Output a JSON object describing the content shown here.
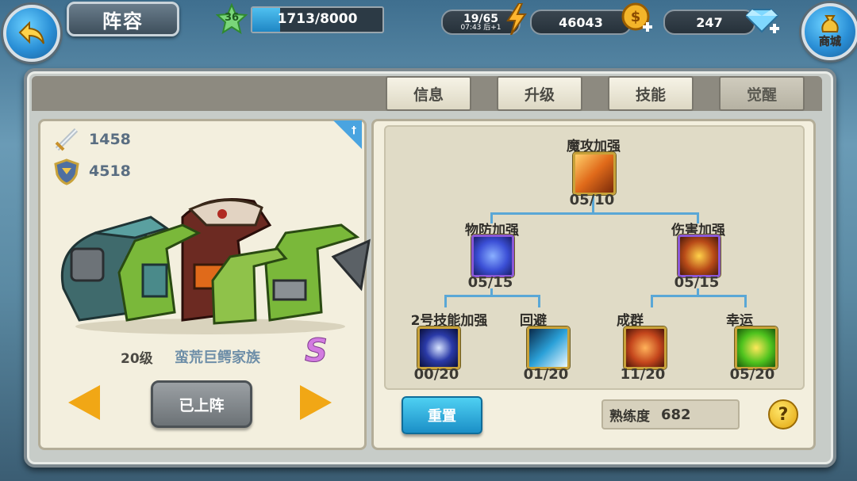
{
  "header": {
    "title": "阵容",
    "player_level": "36",
    "exp_text": "1713/8000",
    "exp_progress": 0.214,
    "stamina": "19/65",
    "stamina_timer": "07:43 后+1",
    "gold": "46043",
    "diamonds": "247",
    "shop_label": "商城"
  },
  "tabs": [
    {
      "label": "信息"
    },
    {
      "label": "升级"
    },
    {
      "label": "技能"
    },
    {
      "label": "觉醒",
      "active": true
    }
  ],
  "hero": {
    "attack": "1458",
    "defense": "4518",
    "level": "20级",
    "name": "蛮荒巨鳄家族",
    "grade": "S",
    "status_button": "已上阵"
  },
  "skill_tree": {
    "root": {
      "label": "魔攻加强",
      "count": "05/10",
      "icon_color": "#e06a1a"
    },
    "mid_left": {
      "label": "物防加强",
      "count": "05/15",
      "icon_color": "#3b4fd6"
    },
    "mid_right": {
      "label": "伤害加强",
      "count": "05/15",
      "icon_color": "#b84a18"
    },
    "leaf1": {
      "label": "2号技能加强",
      "count": "00/20",
      "icon_color": "#2a3aa8"
    },
    "leaf2": {
      "label": "回避",
      "count": "01/20",
      "icon_color": "#2aa0d8"
    },
    "leaf3": {
      "label": "成群",
      "count": "11/20",
      "icon_color": "#c4461c"
    },
    "leaf4": {
      "label": "幸运",
      "count": "05/20",
      "icon_color": "#4fc31e"
    }
  },
  "footer": {
    "reset_label": "重置",
    "proficiency_label": "熟练度",
    "proficiency_value": "682",
    "help_label": "?"
  }
}
